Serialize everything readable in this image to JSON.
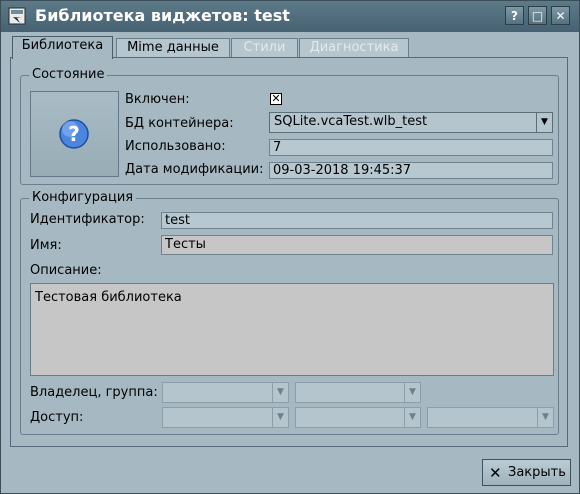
{
  "window": {
    "title": "Библиотека виджетов: test",
    "buttons": {
      "help": "?",
      "maximize": "□",
      "close": "✕"
    }
  },
  "tabs": [
    {
      "label": "Библиотека",
      "active": true,
      "enabled": true
    },
    {
      "label": "Mime данные",
      "active": false,
      "enabled": true
    },
    {
      "label": "Стили",
      "active": false,
      "enabled": false
    },
    {
      "label": "Диагностика",
      "active": false,
      "enabled": false
    }
  ],
  "state_group": {
    "legend": "Состояние",
    "icon": "question-mark-icon",
    "enabled_label": "Включен:",
    "enabled_checked": true,
    "db_label": "БД контейнера:",
    "db_value": "SQLite.vcaTest.wlb_test",
    "used_label": "Использовано:",
    "used_value": "7",
    "modified_label": "Дата модификации:",
    "modified_value": "09-03-2018 19:45:37"
  },
  "config_group": {
    "legend": "Конфигурация",
    "id_label": "Идентификатор:",
    "id_value": "test",
    "name_label": "Имя:",
    "name_value": "Тесты",
    "description_label": "Описание:",
    "description_value": "Тестовая библиотека",
    "owner_label": "Владелец, группа:",
    "access_label": "Доступ:"
  },
  "footer": {
    "close_label": "Закрыть",
    "close_icon": "close-x-icon"
  },
  "colors": {
    "titlebar": "#4f6c7b",
    "window_bg": "#a6b9c3",
    "question_icon": "#4a86e0"
  }
}
